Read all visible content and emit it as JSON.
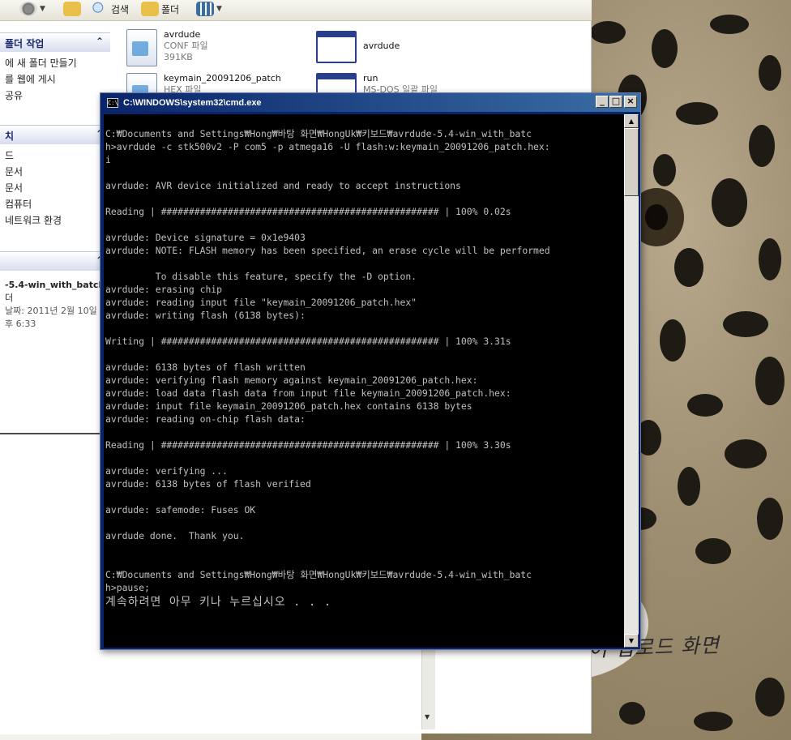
{
  "explorer": {
    "toolbar": {
      "search_label": "검색",
      "folders_label": "폴더"
    },
    "side": {
      "tasks_title": "폴더 작업",
      "tasks": [
        "에 새 폴더 만들기",
        "를 웹에 게시",
        "공유"
      ],
      "places_title": "치",
      "places": [
        "드",
        "문서",
        "문서",
        "컴퓨터",
        "네트워크 환경"
      ],
      "details_title": "",
      "details": [
        "-5.4-win_with_batch",
        "더",
        "날짜: 2011년 2월 10일",
        "후 6:33"
      ]
    },
    "files": [
      {
        "name": "avrdude",
        "type": "CONF 파일",
        "size": "391KB"
      },
      {
        "name": "avrdude",
        "type": "",
        "size": ""
      },
      {
        "name": "keymain_20091206_patch",
        "type": "HEX 파일",
        "size": ""
      },
      {
        "name": "run",
        "type": "MS-DOS 일괄 파일",
        "size": ""
      }
    ]
  },
  "cmd": {
    "title": "C:\\WINDOWS\\system32\\cmd.exe",
    "buttons": {
      "minimize": "_",
      "maximize": "□",
      "close": "×"
    },
    "lines": [
      "C:₩Documents and Settings₩Hong₩바탕 화면₩HongUk₩키보드₩avrdude-5.4-win_with_batc",
      "h>avrdude -c stk500v2 -P com5 -p atmega16 -U flash:w:keymain_20091206_patch.hex:",
      "i",
      "",
      "avrdude: AVR device initialized and ready to accept instructions",
      "",
      "Reading | ################################################## | 100% 0.02s",
      "",
      "avrdude: Device signature = 0x1e9403",
      "avrdude: NOTE: FLASH memory has been specified, an erase cycle will be performed",
      "",
      "         To disable this feature, specify the -D option.",
      "avrdude: erasing chip",
      "avrdude: reading input file \"keymain_20091206_patch.hex\"",
      "avrdude: writing flash (6138 bytes):",
      "",
      "Writing | ################################################## | 100% 3.31s",
      "",
      "avrdude: 6138 bytes of flash written",
      "avrdude: verifying flash memory against keymain_20091206_patch.hex:",
      "avrdude: load data flash data from input file keymain_20091206_patch.hex:",
      "avrdude: input file keymain_20091206_patch.hex contains 6138 bytes",
      "avrdude: reading on-chip flash data:",
      "",
      "Reading | ################################################## | 100% 3.30s",
      "",
      "avrdude: verifying ...",
      "avrdude: 6138 bytes of flash verified",
      "",
      "avrdude: safemode: Fuses OK",
      "",
      "avrdude done.  Thank you.",
      "",
      "",
      "C:₩Documents and Settings₩Hong₩바탕 화면₩HongUk₩키보드₩avrdude-5.4-win_with_batc",
      "h>pause;"
    ],
    "prompt": "계속하려면 아무 키나 누르십시오 . . ."
  },
  "caption": "펌웨어 업로드 화면",
  "colors": {
    "console_bg": "#000000",
    "console_text": "#c0c0c0",
    "titlebar_start": "#0a246a",
    "titlebar_end": "#3a6ea5"
  }
}
